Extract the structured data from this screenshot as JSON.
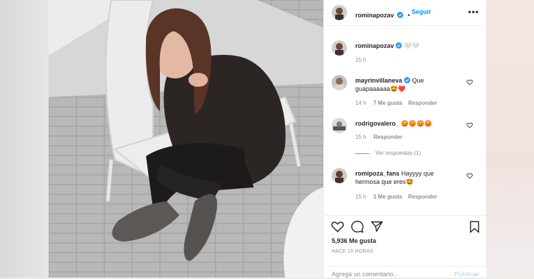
{
  "post": {
    "author": "rominapozav",
    "follow_label": "Seguir",
    "more_label": "•••",
    "caption_text": "🤍🤍",
    "caption_time": "15 h"
  },
  "comments": [
    {
      "user": "mayrinvillaneva",
      "text1": "Que",
      "text2": "guapaaaaaa🤩❤️",
      "time": "14 h",
      "likes": "7 Me gusta",
      "reply": "Responder"
    },
    {
      "user": "rodrigovalero_",
      "text1": "😡😡😡😡",
      "time": "15 h",
      "reply": "Responder",
      "view_replies": "Ver respuestas (1)"
    },
    {
      "user": "romipoza_fans",
      "text1": "Hayyyy que",
      "text2": "hermosa que eres🤩",
      "time": "15 h",
      "likes": "1 Me gusta",
      "reply": "Responder"
    }
  ],
  "footer": {
    "likes": "5,936 Me gusta",
    "posted_ago": "HACE 15 HORAS",
    "comment_placeholder": "Agrega un comentario...",
    "publish_label": "Publicar"
  },
  "colors": {
    "accent": "#0095f6",
    "verified": "#3897f0",
    "muted": "#8e8e8e"
  }
}
